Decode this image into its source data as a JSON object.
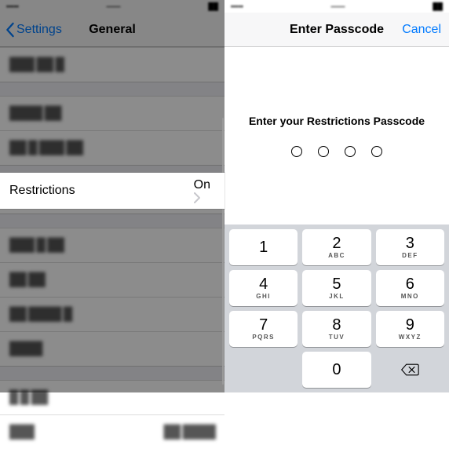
{
  "left": {
    "back_label": "Settings",
    "title": "General",
    "restrictions_label": "Restrictions",
    "restrictions_value": "On"
  },
  "right": {
    "title": "Enter Passcode",
    "cancel_label": "Cancel",
    "prompt": "Enter your Restrictions Passcode"
  },
  "keypad": {
    "k1": {
      "d": "1",
      "l": ""
    },
    "k2": {
      "d": "2",
      "l": "ABC"
    },
    "k3": {
      "d": "3",
      "l": "DEF"
    },
    "k4": {
      "d": "4",
      "l": "GHI"
    },
    "k5": {
      "d": "5",
      "l": "JKL"
    },
    "k6": {
      "d": "6",
      "l": "MNO"
    },
    "k7": {
      "d": "7",
      "l": "PQRS"
    },
    "k8": {
      "d": "8",
      "l": "TUV"
    },
    "k9": {
      "d": "9",
      "l": "WXYZ"
    },
    "k0": {
      "d": "0",
      "l": ""
    }
  }
}
